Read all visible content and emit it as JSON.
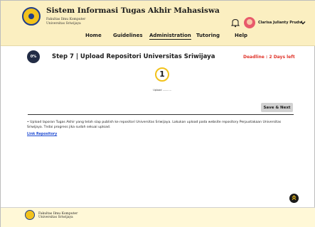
{
  "header": {
    "title": "Sistem Informasi Tugas Akhir Mahasiswa",
    "faculty": "Fakultas Ilmu Komputer",
    "university": "Universitas Sriwijaya",
    "user_name": "Clarisa Julianty Prudvi",
    "nav": [
      "Home",
      "Guidelines",
      "Administration",
      "Tutoring",
      "Help"
    ],
    "active_nav": "Administration"
  },
  "step": {
    "progress_label": "0%",
    "title": "Step 7 | Upload Repositori Universitas Sriwijaya",
    "deadline": "Deadline : 2 Days left",
    "number": "1",
    "label": "Upload ...........",
    "save_label": "Save & Next"
  },
  "content": {
    "description": "• Upload laporan Tugas Akhir yang telah siap publish ke repositori Universitas Sriwijaya. Lakukan upload pada website repository Perpustakaan Universitas Sriwijaya. Tndai progress jika sudah sekuai upload.",
    "link_label": "Link Repository"
  },
  "footer": {
    "faculty": "Fakultas Ilmu Komputer",
    "university": "Universitas Sriwijaya"
  },
  "colors": {
    "header_bg": "#FBEFC1",
    "footer_bg": "#FFF8D7",
    "accent_yellow": "#F2C21B",
    "deadline_red": "#E0352B",
    "link_blue": "#1E4BD2",
    "badge_dark": "#222C45"
  },
  "icons": {
    "logo": "university-logo",
    "notification": "bell-icon",
    "profile": "avatar",
    "menu": "chevron-down-icon",
    "back_to_top": "arrow-up-icon"
  }
}
